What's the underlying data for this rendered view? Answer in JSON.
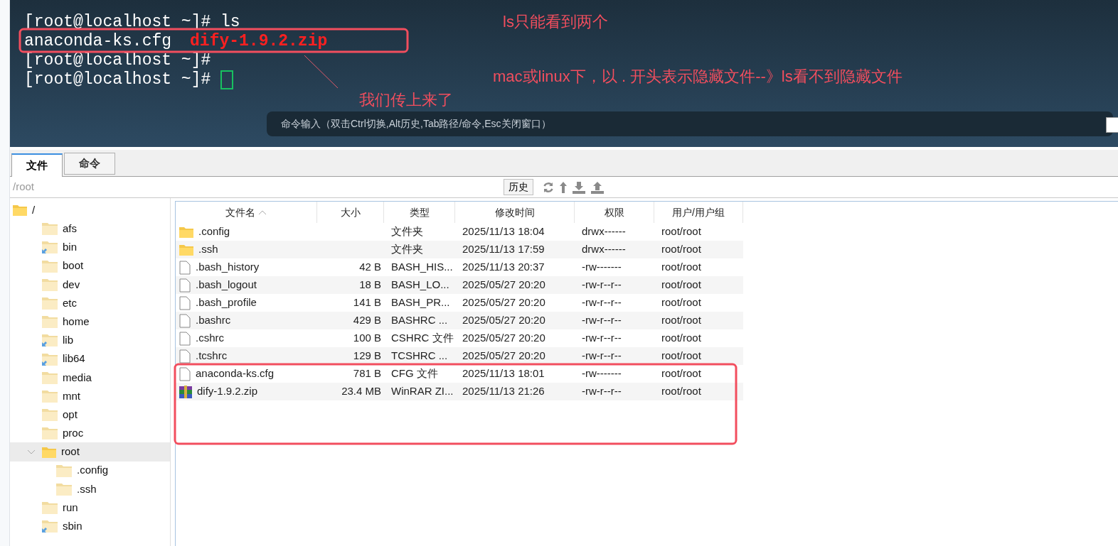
{
  "terminal": {
    "lines": [
      {
        "kind": "prompt",
        "parts": [
          {
            "text": "[root@localhost ~]# ls",
            "color": "#ffffff"
          }
        ]
      },
      {
        "kind": "output",
        "parts": [
          {
            "text": "anaconda-ks.cfg",
            "color": "#ffffff"
          },
          {
            "text": "dify-1.9.2.zip",
            "color": "#ff2020"
          }
        ]
      },
      {
        "kind": "prompt",
        "parts": [
          {
            "text": "[root@localhost ~]#",
            "color": "#ffffff"
          }
        ]
      },
      {
        "kind": "cursor",
        "parts": [
          {
            "text": "[root@localhost ~]#",
            "color": "#ffffff"
          }
        ]
      }
    ],
    "command_bar": {
      "placeholder": "命令输入（双击Ctrl切换,Alt历史,Tab路径/命令,Esc关闭窗口）"
    }
  },
  "annotations": [
    {
      "kind": "note",
      "text": "ls只能看到两个"
    },
    {
      "kind": "note",
      "text": "mac或linux下，以 . 开头表示隐藏文件--》ls看不到隐藏文件"
    },
    {
      "kind": "note",
      "text": "我们传上来了"
    }
  ],
  "tabs": [
    {
      "label": "文件",
      "selected": true
    },
    {
      "label": "命令",
      "selected": false
    }
  ],
  "path": {
    "value": "/root"
  },
  "history_button": "历史",
  "tree": [
    {
      "name": "/",
      "expanded": true,
      "selected": false,
      "link": false,
      "children": [
        {
          "name": "afs",
          "expanded": false,
          "selected": false,
          "link": false
        },
        {
          "name": "bin",
          "expanded": false,
          "selected": false,
          "link": true
        },
        {
          "name": "boot",
          "expanded": false,
          "selected": false,
          "link": false
        },
        {
          "name": "dev",
          "expanded": false,
          "selected": false,
          "link": false
        },
        {
          "name": "etc",
          "expanded": false,
          "selected": false,
          "link": false
        },
        {
          "name": "home",
          "expanded": false,
          "selected": false,
          "link": false
        },
        {
          "name": "lib",
          "expanded": false,
          "selected": false,
          "link": true
        },
        {
          "name": "lib64",
          "expanded": false,
          "selected": false,
          "link": true
        },
        {
          "name": "media",
          "expanded": false,
          "selected": false,
          "link": false
        },
        {
          "name": "mnt",
          "expanded": false,
          "selected": false,
          "link": false
        },
        {
          "name": "opt",
          "expanded": false,
          "selected": false,
          "link": false
        },
        {
          "name": "proc",
          "expanded": false,
          "selected": false,
          "link": false
        },
        {
          "name": "root",
          "expanded": true,
          "selected": true,
          "link": false,
          "children": [
            {
              "name": ".config",
              "expanded": false,
              "selected": false,
              "link": false
            },
            {
              "name": ".ssh",
              "expanded": false,
              "selected": false,
              "link": false
            }
          ]
        },
        {
          "name": "run",
          "expanded": false,
          "selected": false,
          "link": false
        },
        {
          "name": "sbin",
          "expanded": false,
          "selected": false,
          "link": true
        }
      ]
    }
  ],
  "table": {
    "columns": [
      {
        "label": "文件名",
        "sorted": true
      },
      {
        "label": "大小"
      },
      {
        "label": "类型"
      },
      {
        "label": "修改时间"
      },
      {
        "label": "权限"
      },
      {
        "label": "用户/用户组"
      }
    ],
    "rows": [
      {
        "kind": "folder",
        "cells": [
          ".config",
          "",
          "文件夹",
          "2025/11/13 18:04",
          "drwx------",
          "root/root"
        ]
      },
      {
        "kind": "folder",
        "cells": [
          ".ssh",
          "",
          "文件夹",
          "2025/11/13 17:59",
          "drwx------",
          "root/root"
        ]
      },
      {
        "kind": "file",
        "cells": [
          ".bash_history",
          "42 B",
          "BASH_HIS...",
          "2025/11/13 20:37",
          "-rw-------",
          "root/root"
        ]
      },
      {
        "kind": "file",
        "cells": [
          ".bash_logout",
          "18 B",
          "BASH_LO...",
          "2025/05/27 20:20",
          "-rw-r--r--",
          "root/root"
        ]
      },
      {
        "kind": "file",
        "cells": [
          ".bash_profile",
          "141 B",
          "BASH_PR...",
          "2025/05/27 20:20",
          "-rw-r--r--",
          "root/root"
        ]
      },
      {
        "kind": "file",
        "cells": [
          ".bashrc",
          "429 B",
          "BASHRC ...",
          "2025/05/27 20:20",
          "-rw-r--r--",
          "root/root"
        ]
      },
      {
        "kind": "file",
        "cells": [
          ".cshrc",
          "100 B",
          "CSHRC 文件",
          "2025/05/27 20:20",
          "-rw-r--r--",
          "root/root"
        ]
      },
      {
        "kind": "file",
        "cells": [
          ".tcshrc",
          "129 B",
          "TCSHRC ...",
          "2025/05/27 20:20",
          "-rw-r--r--",
          "root/root"
        ]
      },
      {
        "kind": "file",
        "cells": [
          "anaconda-ks.cfg",
          "781 B",
          "CFG 文件",
          "2025/11/13 18:01",
          "-rw-------",
          "root/root"
        ]
      },
      {
        "kind": "archive",
        "cells": [
          "dify-1.9.2.zip",
          "23.4 MB",
          "WinRAR ZI...",
          "2025/11/13 21:26",
          "-rw-r--r--",
          "root/root"
        ]
      }
    ]
  }
}
